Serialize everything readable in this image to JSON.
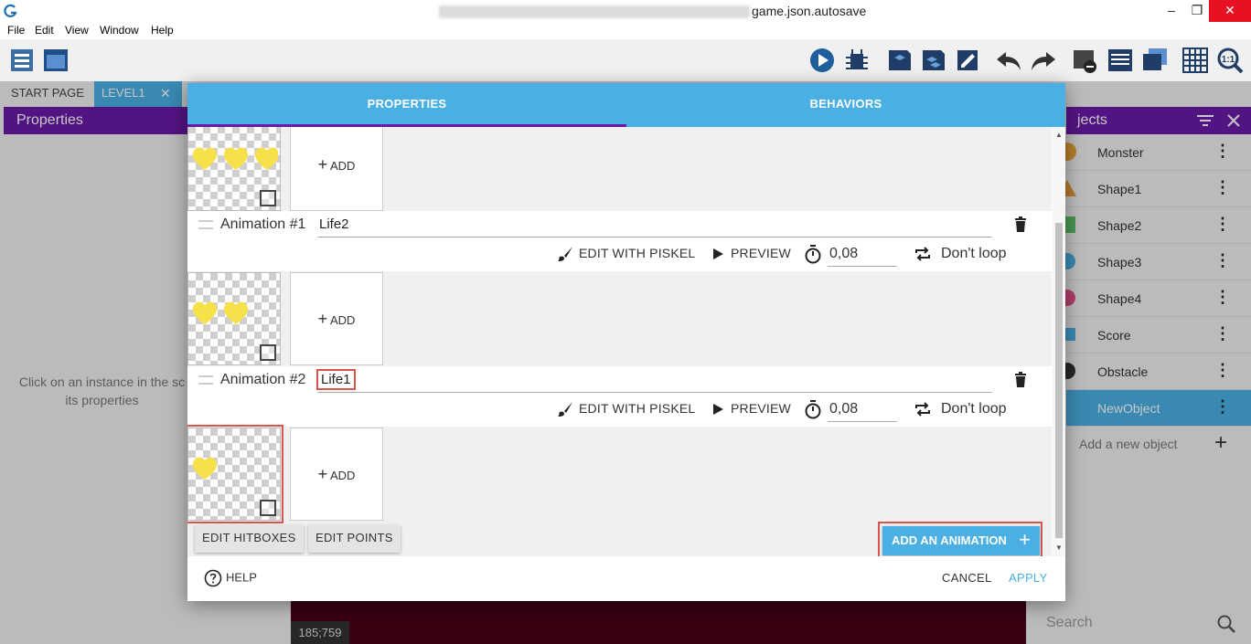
{
  "window": {
    "title": "game.json.autosave",
    "buttons": {
      "minimize": "–",
      "maximize": "❐",
      "close": "✕"
    }
  },
  "menu": [
    "File",
    "Edit",
    "View",
    "Window",
    "Help"
  ],
  "toolbar": {
    "icons": [
      "project-manager-icon",
      "scene-editor-icon",
      "preview-icon",
      "debugger-icon",
      "layer-icon",
      "object-group-icon",
      "edit-icon",
      "undo-icon",
      "redo-icon",
      "delete-icon",
      "layers-list-icon",
      "windows-icon",
      "grid-icon",
      "zoom-icon"
    ]
  },
  "tabs": {
    "start_page": "START PAGE",
    "level": "LEVEL1",
    "close": "✕"
  },
  "properties_panel": {
    "title": "Properties",
    "hint_line1": "Click on an instance in the sc",
    "hint_line2": "its properties"
  },
  "objects_panel": {
    "title": "jects",
    "items": [
      {
        "name": "Monster"
      },
      {
        "name": "Shape1"
      },
      {
        "name": "Shape2"
      },
      {
        "name": "Shape3"
      },
      {
        "name": "Shape4"
      },
      {
        "name": "Score"
      },
      {
        "name": "Obstacle"
      },
      {
        "name": "NewObject",
        "selected": true
      }
    ],
    "add_label": "Add a new object",
    "add_plus": "+",
    "search_placeholder": "Search",
    "menu_glyph": "⋮"
  },
  "scene": {
    "coords": "185;759"
  },
  "dialog": {
    "tabs": {
      "properties": "PROPERTIES",
      "behaviors": "BEHAVIORS"
    },
    "add_frame_label": "ADD",
    "add_glyph": "+",
    "animations": [
      {
        "label": "Animation #1",
        "name": "Life2",
        "edit_with": "EDIT WITH PISKEL",
        "preview": "PREVIEW",
        "time": "0,08",
        "loop": "Don't loop"
      },
      {
        "label": "Animation #2",
        "name": "Life1",
        "edit_with": "EDIT WITH PISKEL",
        "preview": "PREVIEW",
        "time": "0,08",
        "loop": "Don't loop"
      }
    ],
    "edit_hitboxes": "EDIT HITBOXES",
    "edit_points": "EDIT POINTS",
    "add_animation": "ADD AN ANIMATION",
    "add_animation_plus": "+",
    "help": "HELP",
    "cancel": "CANCEL",
    "apply": "APPLY"
  },
  "colors": {
    "accent_blue": "#4ab0e4",
    "accent_purple": "#6b1aa8",
    "highlight_red": "#d9534f",
    "heart_yellow": "#f7e14b"
  }
}
